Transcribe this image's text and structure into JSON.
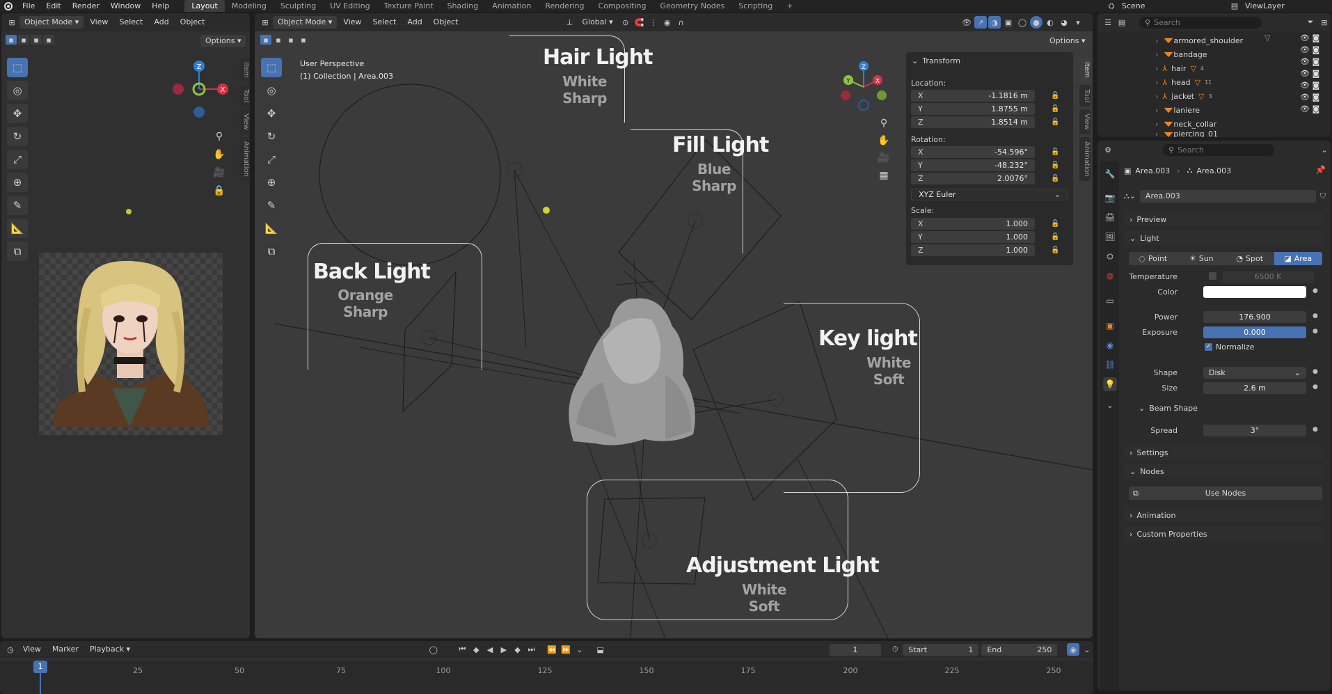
{
  "topbar": {
    "menus": [
      "File",
      "Edit",
      "Render",
      "Window",
      "Help"
    ],
    "workspaces": [
      "Layout",
      "Modeling",
      "Sculpting",
      "UV Editing",
      "Texture Paint",
      "Shading",
      "Animation",
      "Rendering",
      "Compositing",
      "Geometry Nodes",
      "Scripting"
    ],
    "active_workspace": "Layout",
    "add_tab": "+",
    "scene_label": "Scene",
    "view_layer_label": "ViewLayer"
  },
  "left_view": {
    "mode": "Object Mode",
    "menus": [
      "View",
      "Select",
      "Add",
      "Object"
    ],
    "options_label": "Options",
    "side_tabs": [
      "Item",
      "Tool",
      "View",
      "Animation"
    ],
    "gizmo": {
      "z": "Z",
      "x": "X"
    }
  },
  "main_view": {
    "mode": "Object Mode",
    "menus": [
      "View",
      "Select",
      "Add",
      "Object"
    ],
    "transform_orientation": "Global",
    "options_label": "Options",
    "info_line1": "User Perspective",
    "info_line2": "(1) Collection | Area.003",
    "side_tabs": [
      "Item",
      "Tool",
      "View",
      "Animation"
    ],
    "gizmo": {
      "z": "Z",
      "y": "Y",
      "x": "X"
    },
    "labels": {
      "hair": {
        "title": "Hair Light",
        "line1": "White",
        "line2": "Sharp"
      },
      "fill": {
        "title": "Fill Light",
        "line1": "Blue",
        "line2": "Sharp"
      },
      "back": {
        "title": "Back Light",
        "line1": "Orange",
        "line2": "Sharp"
      },
      "key": {
        "title": "Key light",
        "line1": "White",
        "line2": "Soft"
      },
      "adjust": {
        "title": "Adjustment Light",
        "line1": "White",
        "line2": "Soft"
      }
    }
  },
  "transform": {
    "title": "Transform",
    "location_label": "Location:",
    "location": [
      {
        "axis": "X",
        "value": "-1.1816 m"
      },
      {
        "axis": "Y",
        "value": "1.8755 m"
      },
      {
        "axis": "Z",
        "value": "1.8514 m"
      }
    ],
    "rotation_label": "Rotation:",
    "rotation": [
      {
        "axis": "X",
        "value": "-54.596°"
      },
      {
        "axis": "Y",
        "value": "-48.232°"
      },
      {
        "axis": "Z",
        "value": "2.0076°"
      }
    ],
    "rotation_mode": "XYZ Euler",
    "scale_label": "Scale:",
    "scale": [
      {
        "axis": "X",
        "value": "1.000"
      },
      {
        "axis": "Y",
        "value": "1.000"
      },
      {
        "axis": "Z",
        "value": "1.000"
      }
    ]
  },
  "outliner": {
    "search_placeholder": "Search",
    "items": [
      {
        "name": "armored_shoulder",
        "sub": ""
      },
      {
        "name": "bandage",
        "sub": ""
      },
      {
        "name": "hair",
        "sub": "4"
      },
      {
        "name": "head",
        "sub": "11"
      },
      {
        "name": "jacket",
        "sub": "3"
      },
      {
        "name": "laniere",
        "sub": ""
      },
      {
        "name": "neck_collar",
        "sub": ""
      },
      {
        "name": "piercing_01",
        "sub": ""
      }
    ]
  },
  "properties": {
    "search_placeholder": "Search",
    "breadcrumb_object": "Area.003",
    "breadcrumb_data": "Area.003",
    "datablock_name": "Area.003",
    "sections": {
      "preview": "Preview",
      "light": "Light",
      "beam_shape": "Beam Shape",
      "settings": "Settings",
      "nodes": "Nodes",
      "animation": "Animation",
      "custom_properties": "Custom Properties"
    },
    "light_types": [
      "Point",
      "Sun",
      "Spot",
      "Area"
    ],
    "active_light_type": "Area",
    "temperature_label": "Temperature",
    "temperature_value": "6500 K",
    "color_label": "Color",
    "color_value": "#ffffff",
    "power_label": "Power",
    "power_value": "176.900",
    "exposure_label": "Exposure",
    "exposure_value": "0.000",
    "normalize_label": "Normalize",
    "shape_label": "Shape",
    "shape_value": "Disk",
    "size_label": "Size",
    "size_value": "2.6 m",
    "spread_label": "Spread",
    "spread_value": "3°",
    "use_nodes_label": "Use Nodes"
  },
  "timeline": {
    "menus": [
      "View",
      "Marker",
      "Playback"
    ],
    "current_frame": "1",
    "start_label": "Start",
    "start_value": "1",
    "end_label": "End",
    "end_value": "250",
    "ruler": [
      "25",
      "50",
      "75",
      "100",
      "125",
      "150",
      "175",
      "200",
      "225",
      "250"
    ],
    "playhead": "1"
  },
  "colors": {
    "accent": "#4772b3",
    "orange_icon": "#e8862e",
    "green_icon": "#6bbf6b"
  }
}
